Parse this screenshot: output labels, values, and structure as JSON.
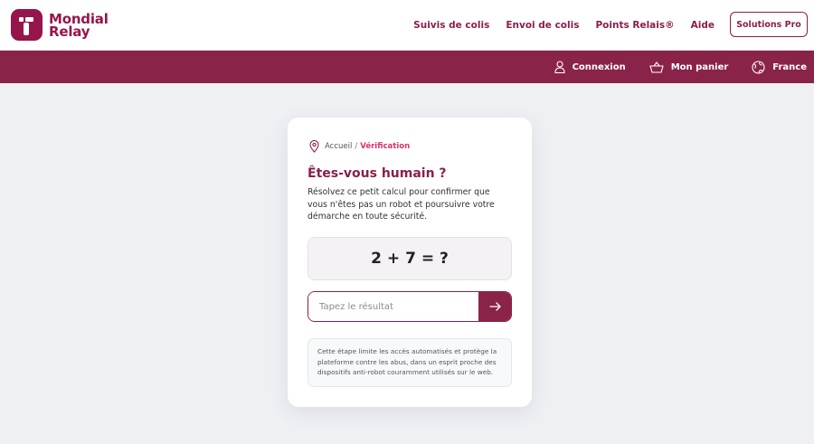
{
  "brand": {
    "name_line1": "Mondial",
    "name_line2": "Relay",
    "color": "#96154a"
  },
  "nav": {
    "items": [
      {
        "label": "Suivis de colis"
      },
      {
        "label": "Envoi de colis"
      },
      {
        "label": "Points Relais®"
      },
      {
        "label": "Aide"
      }
    ],
    "pro_button": "Solutions Pro"
  },
  "subbar": {
    "login": "Connexion",
    "cart": "Mon panier",
    "country": "France",
    "color": "#8a2349"
  },
  "breadcrumb": {
    "home": "Accueil",
    "separator": "/",
    "current": "Vérification"
  },
  "verification": {
    "title": "Êtes-vous humain ?",
    "description": "Résolvez ce petit calcul pour confirmer que vous n'êtes pas un robot et poursuivre votre démarche en toute sécurité.",
    "challenge": "2 + 7 = ?",
    "input_placeholder": "Tapez le résultat",
    "input_value": "",
    "note": "Cette étape limite les accès automatisés et protège la plateforme contre les abus, dans un esprit proche des dispositifs anti-robot couramment utilisés sur le web."
  },
  "icons": [
    "user-icon",
    "basket-icon",
    "globe-icon",
    "location-pin-icon",
    "arrow-right-icon"
  ]
}
